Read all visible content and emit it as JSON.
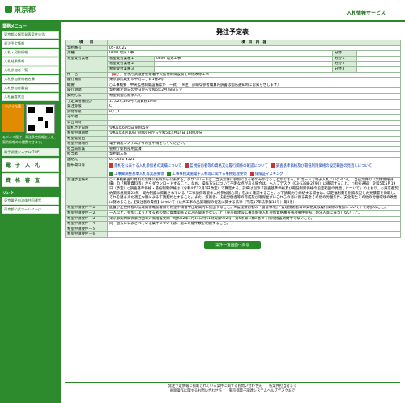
{
  "header": {
    "logo": "東京都",
    "service": "入札情報サービス"
  },
  "sidebar": {
    "sec1": "業務メニュー",
    "items": [
      "東京都公報等発表案件公告",
      "発注予定情報",
      "入札・契約情報",
      "入札結果情報",
      "入札参加者一覧",
      "入札参加資格者名簿",
      "入札参加者審査",
      "入札審査状況"
    ],
    "mobile": "モバイル版",
    "note": "モバイル版は、発注予定情報と入札、契約情報のみ閲覧できます。",
    "btn_ekan": "電子調達システム(TOP)",
    "btn_nyusatsu": "電　子　入　札",
    "btn_shikaku": "資　格　審　査",
    "links_head": "リンク",
    "links": [
      "東京電子自治体共同運営",
      "東京都公式ホームページ"
    ]
  },
  "page": {
    "title": "発注予定表"
  },
  "table": {
    "h_item": "項　　目",
    "h_content": "項　目　内　容",
    "keiyaku_no_l": "契約番号",
    "keiyaku_no": "05-70122",
    "gyoshu_l": "業種",
    "gyoshu": "0800 電気工事",
    "bunya_l": "分野",
    "kibo_l": "希望受付業種",
    "kibo": [
      {
        "k": "希望受付業種１",
        "v": "0800 電気工事",
        "b": "分野１"
      },
      {
        "k": "希望受付業種２",
        "v": "",
        "b": "分野２"
      },
      {
        "k": "希望受付業種３",
        "v": "",
        "b": "分野３"
      }
    ],
    "kenmei_l": "件　名",
    "kenmei_tag": "【電子】",
    "kenmei": "警視庁武蔵野警察署中央監視制御設備その他改修工事",
    "basho_l": "履行場所",
    "basho": "東京都武蔵野市中町二丁目1番2号",
    "gaiyo_l": "概要",
    "gaiyo": "○工事概要　中央監視制御設備ほか　一式　（※注　詳細な参考積算内訳書は指名通知時にお知らせします）",
    "kikan_l": "履行期間",
    "kikan": "契約確定の日の翌日から令和6年2月28日まで",
    "hoho_l": "契約方法",
    "hoho": "希望制指名競争入札",
    "kakaku_l": "予定価格(税込)",
    "kakaku": "17,029,100円（消費税10%）",
    "tokyu_l": "発注等級",
    "tokyu": "C",
    "ukezuke_l": "受付等級",
    "ukezuke": "B,C,D",
    "sonota_l": "その他",
    "sonota": "",
    "koji_l": "公告日時",
    "koji": "",
    "kohyo_l": "開札予定日時",
    "kohyo": "令和5年6月5日 9時05分",
    "kibo_kikan_l": "希望申請期間",
    "kibo_kikan": "令和5年4月10日 9時00分から令和5年4月14日 16時00分",
    "kibo_sho_l": "希望書提出",
    "kibo_sho": "",
    "kibo_basho_l": "希望申請場所",
    "kibo_basho": "電子調達システムから希望申請をしてください。",
    "tanto_l": "担当局所属",
    "tanto": "警視庁総務部用度課",
    "tantosha_l": "担当者",
    "tantosha": "契約第三係",
    "tel_l": "連絡先",
    "tel": "03-3581-4321",
    "docs_l": "配布資料等",
    "docs": [
      "落札を公表する入札参加者の実績について",
      "監視技術者等の資格又は履行関係の確認について",
      "調査基準価格及び最低制限価格の設定範囲の見直しについて",
      "工事費調整基本入札等実施要領",
      "工事事務実施電子入札等に関する事務処理要領",
      "保険証マスキング"
    ],
    "chui_l": "発注予定備考",
    "chui": "○工事概要書の資料を案件公表時から公表する。ダウンロードは、当該案件に参加できる者のみが行うことができる。ICカードで電子入札にログインし、当該案件の「案件情報詳細」の「積算資料等」からダウンロードすること。なお、操作方法について不明な点がある場合は、ヘルプデスク（03-5388-2790）に確認すること。○指名通知　令和5年5月19日（予定）○調査基準価格・最低制限価格は（令和4年12月1日改定）で算定する。詳細は別添「調査基準価格及び最低制限価格の設定範囲の見直しについて」のとおり。○東京都契約関係規則第23条・契約制度に掲載されている「工事請負等競争入札参加者心得」をよく確認すること。○下請契約を締結する場合は、法定福利費を別枠表記した見積書を徴取し、それを踏まえた適正な額による下請契約とすること。また、技術者、技能労働者等の育成及び確保並びにこれらの者に係る賃金その他の労働条件、安全衛生その他の労働環境の改善に努めること。【受注者の責務】について（公共工事の品質確保の促進に関する法律（平成17年法律第18号）第8条）",
    "joken": [
      {
        "k": "希望申請要件－１",
        "v": "配置予定技術者の監理関係確認書類を希望申請書中出期間内に提出すること。※監理技術者の「留意事項」「監理技術者等の資格又は履行関係の確認について」を必読のこと。"
      },
      {
        "k": "希望申請要件－２",
        "v": "一人以上、参加しようとする者の間に資本関係又は人的関係がないこと（東京都建設工事等競争入札参加資格審査事項要件参照）の法人等に該当しないこと。"
      },
      {
        "k": "希望申請要件－３",
        "v": "東京都契約関係暴力団等対策措置要綱（昭和62年1月14日付61財契第922号）第5条第1項に基づく排除措置期間中でないこと。"
      },
      {
        "k": "希望申請要件－４",
        "v": "同一過去に公表されている案件については、施工可能件数を制限すること。"
      },
      {
        "k": "希望申請要件－５",
        "v": ""
      },
      {
        "k": "希望申請要件－６",
        "v": ""
      }
    ],
    "back": "案件一覧画面へ戻る"
  },
  "footer": {
    "l1": "発注予定情報に掲載されている案件に関するお問い合わせ先　　各案件担当者まで",
    "l2": "画面操作に関するお問い合わせ先　　東京都電子調達システムヘルプデスクまで"
  }
}
